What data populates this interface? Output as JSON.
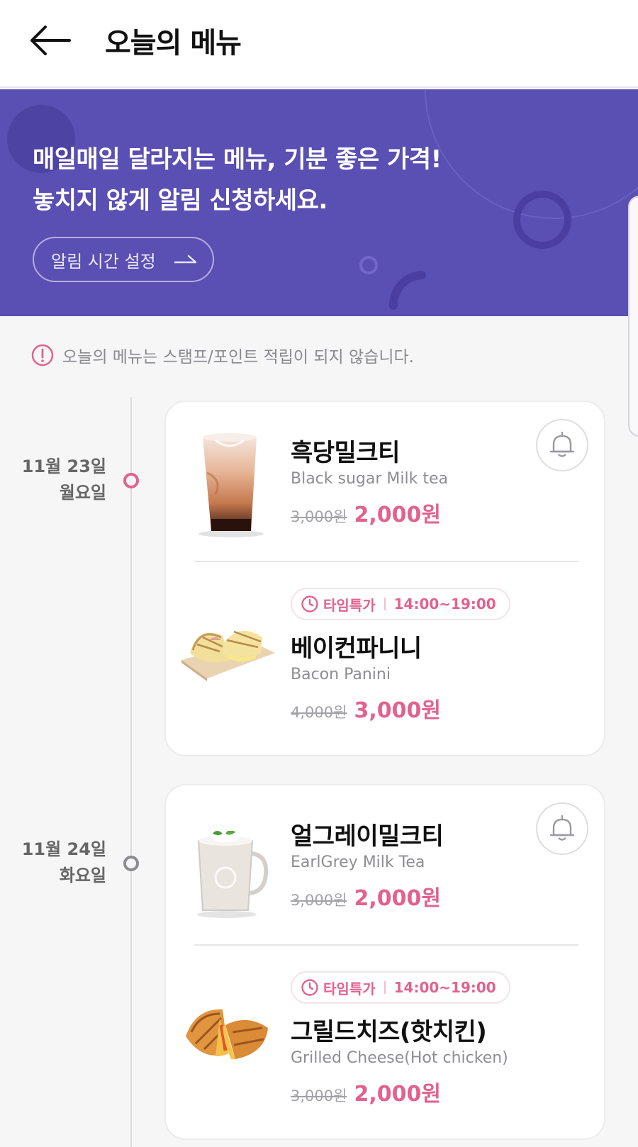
{
  "header": {
    "title": "오늘의 메뉴",
    "back_icon": "arrow-left-icon"
  },
  "banner": {
    "line1": "매일매일 달라지는 메뉴, 기분 좋은 가격!",
    "line2": "놓치지 않게 알림 신청하세요.",
    "button_label": "알림 시간 설정",
    "background_color": "#5a4fb3"
  },
  "notice": {
    "text": "오늘의 메뉴는 스탬프/포인트 적립이 되지 않습니다.",
    "icon": "exclamation-circle-icon"
  },
  "accent_color": "#e2628d",
  "days": [
    {
      "date": "11월 23일",
      "weekday": "월요일",
      "items": [
        {
          "name": "흑당밀크티",
          "eng": "Black sugar Milk tea",
          "old_price": "3,000원",
          "new_price": "2,000원"
        },
        {
          "badge_label": "타임특가",
          "badge_time": "14:00~19:00",
          "name": "베이컨파니니",
          "eng": "Bacon Panini",
          "old_price": "4,000원",
          "new_price": "3,000원"
        }
      ]
    },
    {
      "date": "11월 24일",
      "weekday": "화요일",
      "items": [
        {
          "name": "얼그레이밀크티",
          "eng": "EarlGrey Milk Tea",
          "old_price": "3,000원",
          "new_price": "2,000원"
        },
        {
          "badge_label": "타임특가",
          "badge_time": "14:00~19:00",
          "name": "그릴드치즈(핫치킨)",
          "eng": "Grilled Cheese(Hot chicken)",
          "old_price": "3,000원",
          "new_price": "2,000원"
        }
      ]
    }
  ]
}
